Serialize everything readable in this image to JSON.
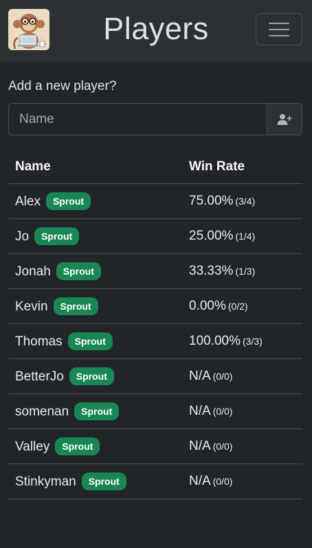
{
  "header": {
    "title": "Players",
    "logo_icon": "monkey-coder-logo-icon",
    "menu_icon": "hamburger-menu-icon"
  },
  "add_player": {
    "label": "Add a new player?",
    "placeholder": "Name",
    "value": "",
    "button_icon": "add-user-icon"
  },
  "table": {
    "headers": {
      "name": "Name",
      "win_rate": "Win Rate"
    },
    "rows": [
      {
        "name": "Alex",
        "badge": "Sprout",
        "rate": "75.00%",
        "record": "(3/4)"
      },
      {
        "name": "Jo",
        "badge": "Sprout",
        "rate": "25.00%",
        "record": "(1/4)"
      },
      {
        "name": "Jonah",
        "badge": "Sprout",
        "rate": "33.33%",
        "record": "(1/3)"
      },
      {
        "name": "Kevin",
        "badge": "Sprout",
        "rate": "0.00%",
        "record": "(0/2)"
      },
      {
        "name": "Thomas",
        "badge": "Sprout",
        "rate": "100.00%",
        "record": "(3/3)"
      },
      {
        "name": "BetterJo",
        "badge": "Sprout",
        "rate": "N/A",
        "record": "(0/0)"
      },
      {
        "name": "somenan",
        "badge": "Sprout",
        "rate": "N/A",
        "record": "(0/0)"
      },
      {
        "name": "Valley",
        "badge": "Sprout",
        "rate": "N/A",
        "record": "(0/0)"
      },
      {
        "name": "Stinkyman",
        "badge": "Sprout",
        "rate": "N/A",
        "record": "(0/0)"
      }
    ]
  },
  "colors": {
    "background": "#212529",
    "navbar": "#2b3035",
    "badge": "#198754",
    "border": "#495057"
  }
}
